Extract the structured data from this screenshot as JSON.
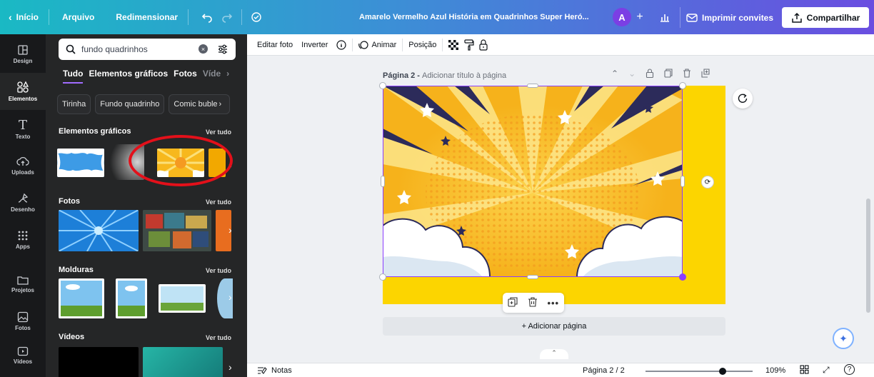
{
  "topbar": {
    "back_label": "Início",
    "file_label": "Arquivo",
    "resize_label": "Redimensionar",
    "doc_title": "Amarelo Vermelho Azul História em Quadrinhos Super Heró...",
    "avatar_letter": "A",
    "print_label": "Imprimir convites",
    "share_label": "Compartilhar"
  },
  "rail": {
    "items": [
      {
        "label": "Design",
        "icon": "layout-icon"
      },
      {
        "label": "Elementos",
        "icon": "shapes-icon"
      },
      {
        "label": "Texto",
        "icon": "text-icon"
      },
      {
        "label": "Uploads",
        "icon": "cloud-upload-icon"
      },
      {
        "label": "Desenho",
        "icon": "draw-icon"
      },
      {
        "label": "Apps",
        "icon": "grid-icon"
      },
      {
        "label": "Projetos",
        "icon": "folder-icon"
      },
      {
        "label": "Fotos",
        "icon": "photo-icon"
      },
      {
        "label": "Vídeos",
        "icon": "video-icon"
      }
    ]
  },
  "panel": {
    "search_value": "fundo quadrinhos",
    "tabs": [
      "Tudo",
      "Elementos gráficos",
      "Fotos",
      "Víde"
    ],
    "chips": [
      "Tirinha",
      "Fundo quadrinho",
      "Comic buble"
    ],
    "sections": {
      "graphics": "Elementos gráficos",
      "photos": "Fotos",
      "frames": "Molduras",
      "videos": "Vídeos"
    },
    "see_all": "Ver tudo"
  },
  "toolbar": {
    "edit_photo": "Editar foto",
    "flip": "Inverter",
    "animate": "Animar",
    "position": "Posição"
  },
  "canvas": {
    "page_label": "Página 2",
    "page_title_hint": "Adicionar título à página",
    "add_page": "+ Adicionar página"
  },
  "footer": {
    "notes": "Notas",
    "page_indicator": "Página 2 / 2",
    "zoom": "109%",
    "zoom_level": 0.72
  },
  "colors": {
    "accent": "#8b3dff",
    "doc_background": "#fcd500",
    "highlight_circle": "#e3101a"
  }
}
